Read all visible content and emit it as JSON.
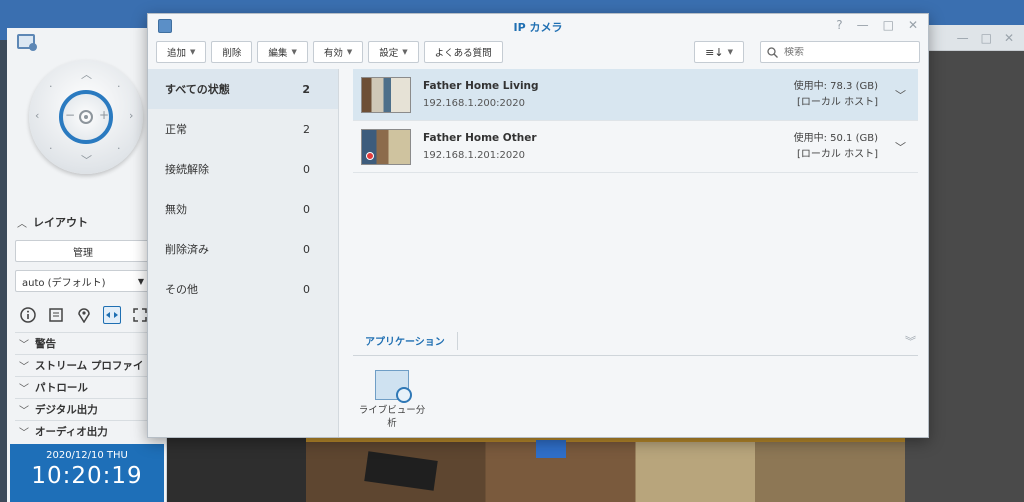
{
  "window": {
    "title": "IP カメラ",
    "controls": {
      "help": "?",
      "minimize": "—",
      "maximize": "□",
      "close": "✕"
    }
  },
  "toolbar": {
    "add": "追加",
    "delete": "削除",
    "edit": "編集",
    "enable": "有効",
    "settings": "設定",
    "faq": "よくある質問",
    "sort_icon": "≡↓",
    "search_placeholder": "検索"
  },
  "sidebar": {
    "items": [
      {
        "label": "すべての状態",
        "count": "2"
      },
      {
        "label": "正常",
        "count": "2"
      },
      {
        "label": "接続解除",
        "count": "0"
      },
      {
        "label": "無効",
        "count": "0"
      },
      {
        "label": "削除済み",
        "count": "0"
      },
      {
        "label": "その他",
        "count": "0"
      }
    ]
  },
  "cameras": [
    {
      "name": "Father Home Living",
      "address": "192.168.1.200:2020",
      "usage": "使用中: 78.3 (GB)",
      "host": "[ローカル ホスト]"
    },
    {
      "name": "Father Home Other",
      "address": "192.168.1.201:2020",
      "usage": "使用中: 50.1 (GB)",
      "host": "[ローカル ホスト]"
    }
  ],
  "applications": {
    "tab": "アプリケーション",
    "tile": "ライブビュー分析"
  },
  "left_panel": {
    "layout_section": "レイアウト",
    "manage": "管理",
    "layout_value": "auto (デフォルト)",
    "sections": [
      "警告",
      "ストリーム プロファイ",
      "パトロール",
      "デジタル出力",
      "オーディオ出力"
    ],
    "clock_date": "2020/12/10  THU",
    "clock_time": "10:20:19"
  },
  "colors": {
    "accent": "#1f6fb2",
    "selected_row": "#d8e6f0",
    "clock_bg": "#1e6fb8",
    "record": "#e23b3b"
  }
}
